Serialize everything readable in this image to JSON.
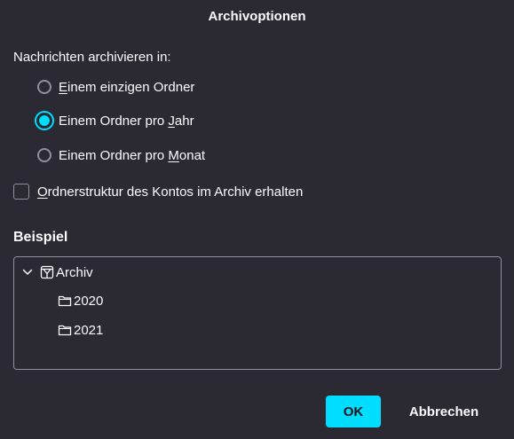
{
  "dialog": {
    "title": "Archivoptionen"
  },
  "granularity": {
    "label": "Nachrichten archivieren in:",
    "options": [
      {
        "pre": "",
        "key": "E",
        "post": "inem einzigen Ordner",
        "checked": false
      },
      {
        "pre": "Einem Ordner pro ",
        "key": "J",
        "post": "ahr",
        "checked": true
      },
      {
        "pre": "Einem Ordner pro ",
        "key": "M",
        "post": "onat",
        "checked": false
      }
    ]
  },
  "keep_structure": {
    "pre": "",
    "key": "O",
    "post": "rdnerstruktur des Kontos im Archiv erhalten",
    "checked": false
  },
  "example": {
    "heading": "Beispiel",
    "root": {
      "label": "Archiv",
      "icon": "archive-icon",
      "expanded": true
    },
    "children": [
      {
        "label": "2020",
        "icon": "folder-icon"
      },
      {
        "label": "2021",
        "icon": "folder-icon"
      }
    ]
  },
  "buttons": {
    "ok_label": "OK",
    "cancel_label": "Abbrechen"
  },
  "colors": {
    "background": "#2b2a33",
    "accent": "#00ddff",
    "text": "#fbfbfe",
    "border": "#8f8f9d"
  }
}
